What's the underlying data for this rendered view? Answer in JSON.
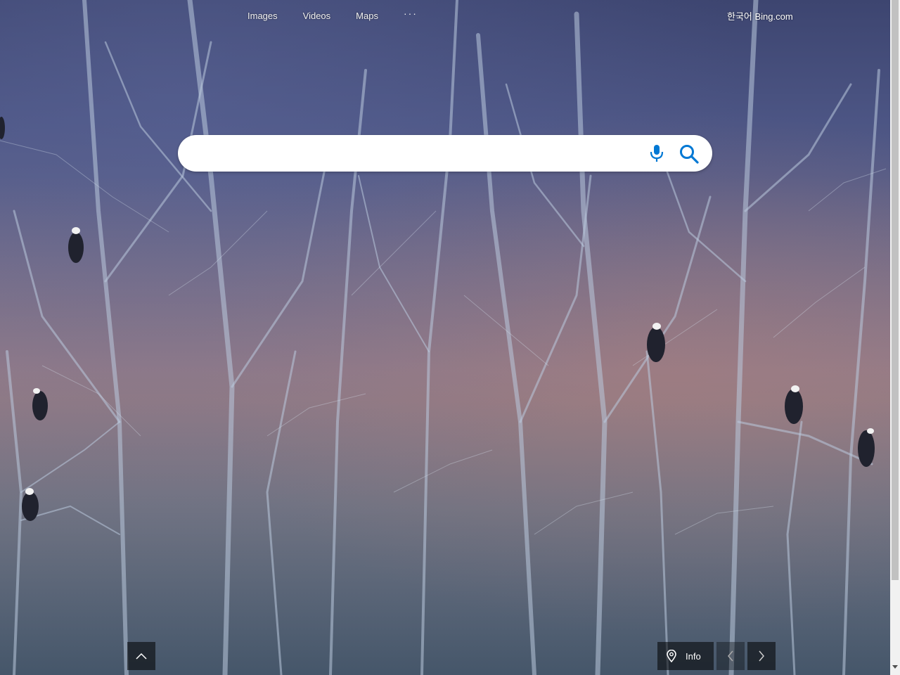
{
  "nav": {
    "links": [
      {
        "label": "Images"
      },
      {
        "label": "Videos"
      },
      {
        "label": "Maps"
      }
    ],
    "more_label": "···",
    "region_label": "한국어 Bing.com"
  },
  "search": {
    "value": "",
    "placeholder": ""
  },
  "controls": {
    "info_label": "Info"
  },
  "icons": {
    "mic": "microphone-icon",
    "search": "search-icon",
    "up": "chevron-up-icon",
    "pin": "location-pin-icon",
    "prev": "chevron-left-icon",
    "next": "chevron-right-icon"
  },
  "colors": {
    "accent": "#0078d4",
    "sky": "#4c5584"
  }
}
